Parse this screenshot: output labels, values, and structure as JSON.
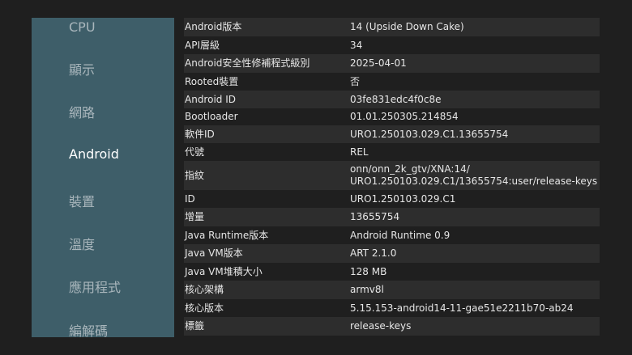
{
  "sidebar": {
    "items": [
      {
        "label": "CPU"
      },
      {
        "label": "顯示"
      },
      {
        "label": "網路"
      },
      {
        "label": "Android"
      },
      {
        "label": "裝置"
      },
      {
        "label": "溫度"
      },
      {
        "label": "應用程式"
      },
      {
        "label": "編解碼"
      }
    ],
    "active": "Android"
  },
  "info": {
    "rows": [
      {
        "key": "Android版本",
        "value": "14 (Upside Down Cake)"
      },
      {
        "key": "API層級",
        "value": "34"
      },
      {
        "key": "Android安全性修補程式級別",
        "value": "2025-04-01"
      },
      {
        "key": "Rooted裝置",
        "value": "否"
      },
      {
        "key": "Android ID",
        "value": "03fe831edc4f0c8e"
      },
      {
        "key": "Bootloader",
        "value": "01.01.250305.214854"
      },
      {
        "key": "軟件ID",
        "value": "URO1.250103.029.C1.13655754"
      },
      {
        "key": "代號",
        "value": "REL"
      },
      {
        "key": "指紋",
        "value": "onn/onn_2k_gtv/XNA:14/",
        "value2": "URO1.250103.029.C1/13655754:user/release-keys"
      },
      {
        "key": "ID",
        "value": "URO1.250103.029.C1"
      },
      {
        "key": "增量",
        "value": "13655754"
      },
      {
        "key": "Java Runtime版本",
        "value": "Android Runtime 0.9"
      },
      {
        "key": "Java VM版本",
        "value": "ART 2.1.0"
      },
      {
        "key": "Java VM堆積大小",
        "value": "128 MB"
      },
      {
        "key": "核心架構",
        "value": "armv8l"
      },
      {
        "key": "核心版本",
        "value": "5.15.153-android14-11-gae51e2211b70-ab24"
      },
      {
        "key": "標籤",
        "value": "release-keys"
      }
    ]
  },
  "colors": {
    "background": "#1f1f1f",
    "sidebar": "#3e5e69",
    "row_alt": "#2d2d2d",
    "text": "#e6e6e6",
    "nav_inactive": "#a9b6bc",
    "nav_active": "#ffffff"
  }
}
